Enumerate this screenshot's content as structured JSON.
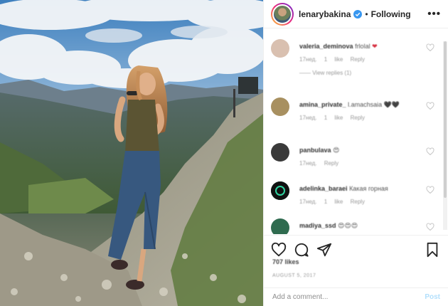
{
  "photo": {
    "alt_name": "post-photo"
  },
  "header": {
    "username": "lenarybakina",
    "separator": "•",
    "following_label": "Following",
    "more_label": "•••"
  },
  "comments": [
    {
      "user": "valeria_deminova",
      "text": "frlolal",
      "emoji": "❤",
      "meta": "17нед. 1 like Reply",
      "view": "—— View replies (1)",
      "avatar_color": "#d9c0b0"
    },
    {
      "user": "amina_private_",
      "text": "l.amachsaia",
      "emoji": "🖤🖤",
      "meta": "17нед. 1 like Reply",
      "view": "",
      "avatar_color": "#a89060"
    },
    {
      "user": "panbulava",
      "text": "",
      "emoji": "😍",
      "meta": "17нед. Reply",
      "view": "",
      "avatar_color": "#3a3a3a"
    },
    {
      "user": "adelinka_baraei",
      "text": "Какая горная",
      "emoji": "",
      "meta": "17нед. 1 like Reply",
      "view": "",
      "avatar_color": "#111111"
    },
    {
      "user": "madiya_ssd",
      "text": "",
      "emoji": "😍😍😍",
      "meta": "",
      "view": "",
      "avatar_color": "#2f6b4f"
    }
  ],
  "actions": {
    "like_icon": "heart-outline-icon",
    "comment_icon": "comment-bubble-icon",
    "share_icon": "paper-plane-icon",
    "save_icon": "bookmark-icon"
  },
  "likes_text": "707 likes",
  "date_text": "AUGUST 5, 2017",
  "comment_box": {
    "placeholder": "Add a comment...",
    "post_label": "Post"
  },
  "colors": {
    "accent_blue": "#0095f6",
    "post_disabled": "#b2dffc",
    "verified_blue": "#3897f0",
    "heart_red": "#d62f40"
  }
}
